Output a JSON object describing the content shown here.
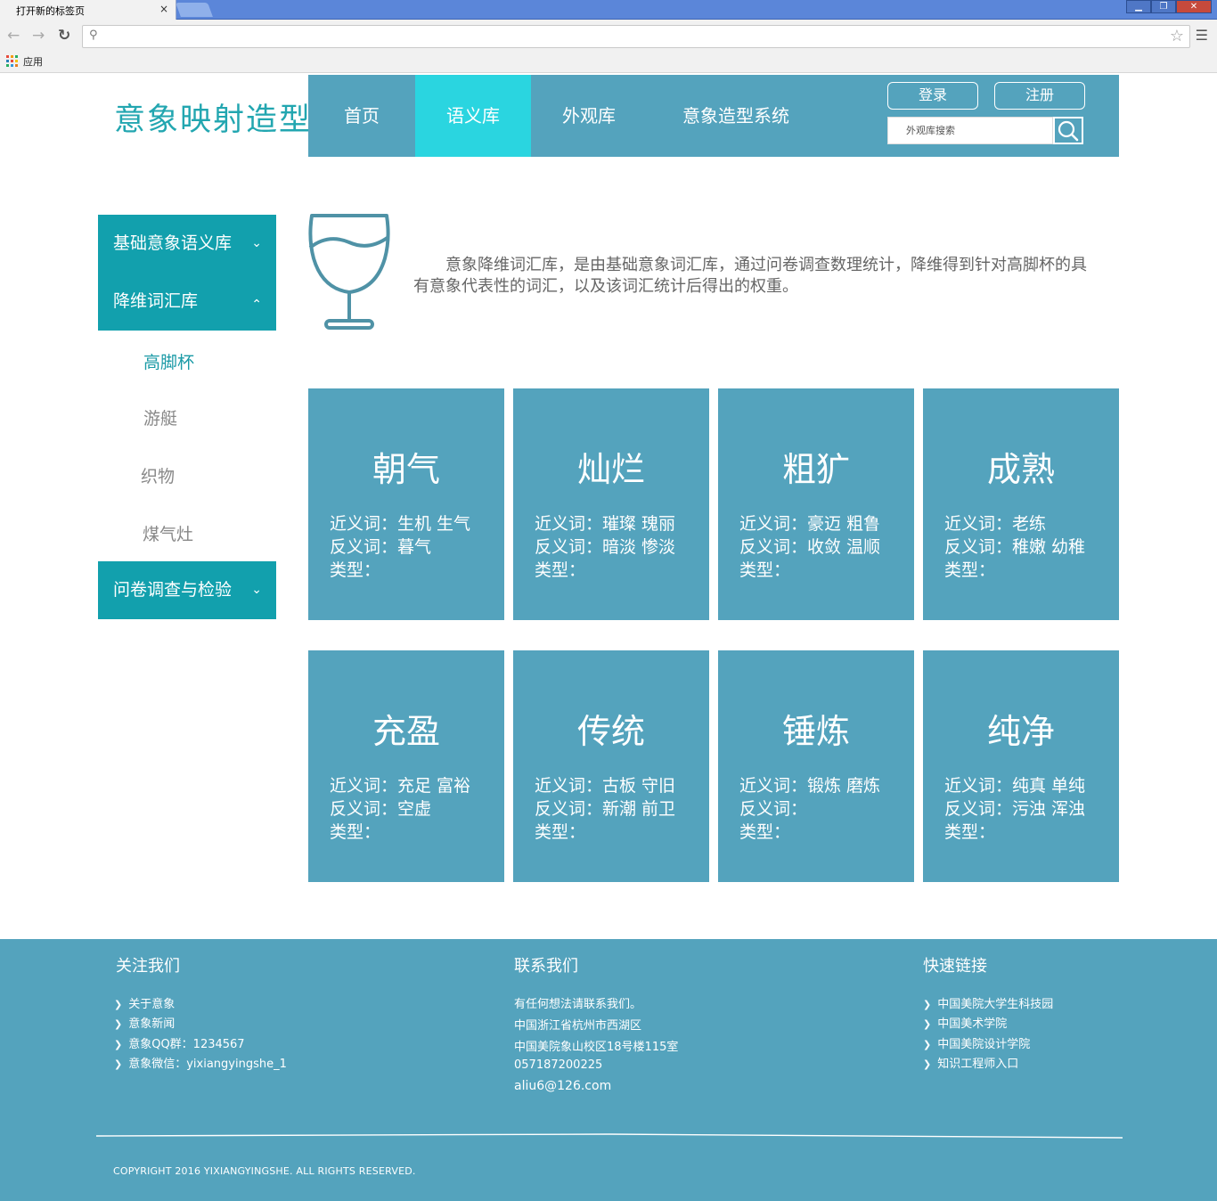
{
  "browser": {
    "tab_title": "打开新的标签页",
    "tab_close": "×",
    "window_buttons": [
      "▁",
      "❐",
      "✕"
    ],
    "apps_label": "应用"
  },
  "site": {
    "logo": "意象映射造型",
    "nav": [
      "首页",
      "语义库",
      "外观库",
      "意象造型系统"
    ],
    "active_nav": "语义库",
    "login_label": "登录",
    "register_label": "注册",
    "search_placeholder": "外观库搜索"
  },
  "sidebar": {
    "groups": [
      {
        "label": "基础意象语义库",
        "chevron": "down"
      },
      {
        "label": "降维词汇库",
        "chevron": "up"
      },
      {
        "label": "问卷调查与检验",
        "chevron": "down"
      }
    ],
    "sub_items": [
      "高脚杯",
      "游艇",
      "织物",
      "煤气灶"
    ],
    "active_sub": "高脚杯"
  },
  "intro": {
    "icon": "wine-glass-icon",
    "text": "意象降维词汇库，是由基础意象词汇库，通过问卷调查数理统计，降维得到针对高脚杯的具有意象代表性的词汇，以及该词汇统计后得出的权重。"
  },
  "cards": [
    {
      "title": "朝气",
      "near": "近义词：生机 生气",
      "anti": "反义词：暮气",
      "type": "类型："
    },
    {
      "title": "灿烂",
      "near": "近义词：璀璨 瑰丽",
      "anti": "反义词：暗淡 惨淡",
      "type": "类型："
    },
    {
      "title": "粗犷",
      "near": "近义词：豪迈 粗鲁",
      "anti": "反义词：收敛 温顺",
      "type": "类型："
    },
    {
      "title": "成熟",
      "near": "近义词：老练",
      "anti": "反义词：稚嫩 幼稚",
      "type": "类型："
    },
    {
      "title": "充盈",
      "near": "近义词：充足 富裕",
      "anti": "反义词：空虚",
      "type": "类型："
    },
    {
      "title": "传统",
      "near": "近义词：古板 守旧",
      "anti": "反义词：新潮 前卫",
      "type": "类型："
    },
    {
      "title": "锤炼",
      "near": "近义词：锻炼 磨炼",
      "anti": "反义词：",
      "type": "类型："
    },
    {
      "title": "纯净",
      "near": "近义词：纯真 单纯",
      "anti": "反义词：污浊 浑浊",
      "type": "类型："
    }
  ],
  "footer": {
    "follow": {
      "title": "关注我们",
      "items": [
        "关于意象",
        "意象新闻",
        "意象QQ群：1234567",
        "意象微信：yixiangyingshe_1"
      ]
    },
    "contact": {
      "title": "联系我们",
      "lines": [
        "有任何想法请联系我们。",
        "中国浙江省杭州市西湖区",
        "中国美院象山校区18号楼115室",
        "057187200225",
        "aliu6@126.com"
      ]
    },
    "links": {
      "title": "快速链接",
      "items": [
        "中国美院大学生科技园",
        "中国美术学院",
        "中国美院设计学院",
        "知识工程师入口"
      ]
    },
    "copyright": "COPYRIGHT 2016 YIXIANGYINGSHE. ALL RIGHTS RESERVED."
  },
  "colors": {
    "nav_bg": "#54a3bd",
    "nav_active": "#2ad5e0",
    "sidebar_bg": "#12a0ad",
    "logo": "#22a6b0",
    "card_bg": "#54a3bd",
    "footer_bg": "#54a3bd"
  }
}
